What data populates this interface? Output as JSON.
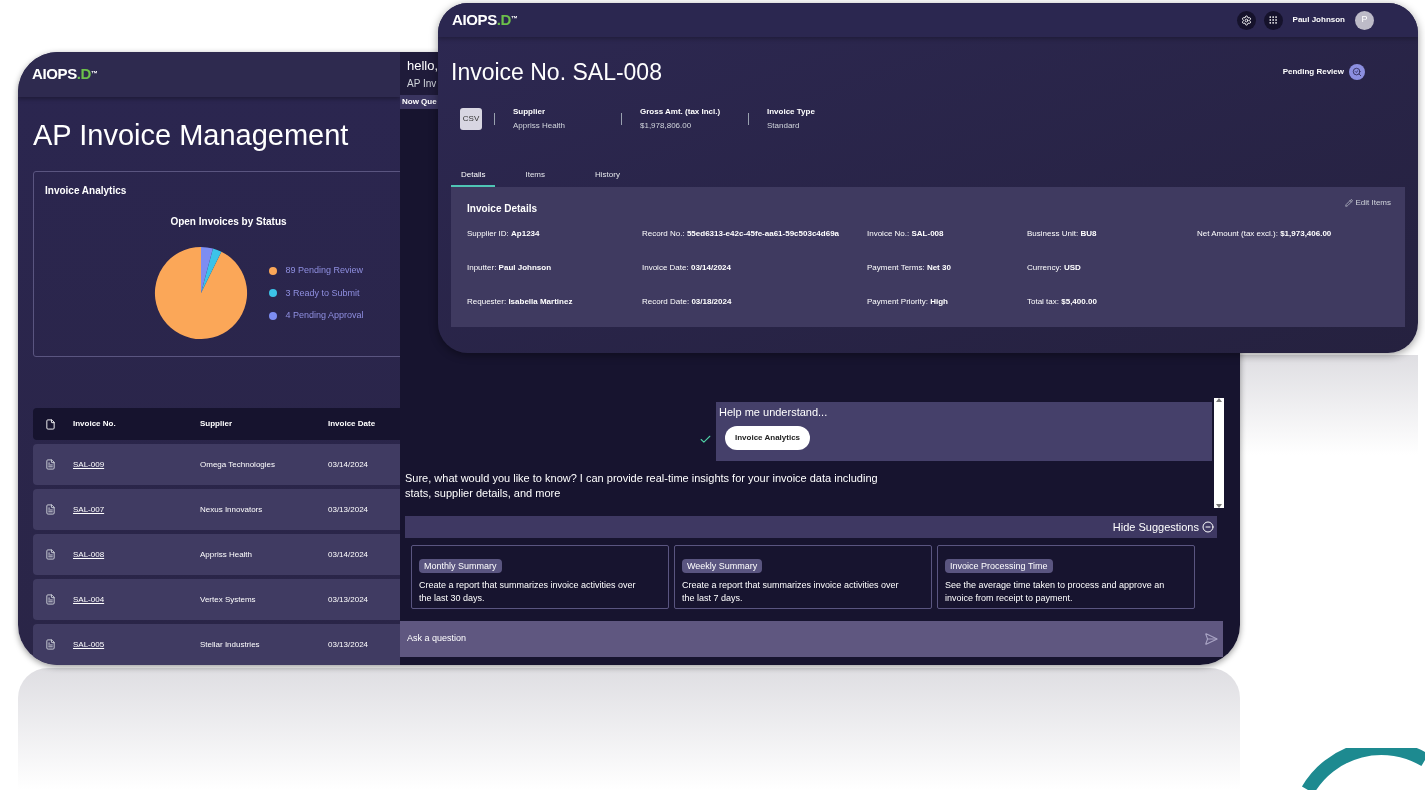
{
  "dashboard": {
    "logo": {
      "text": "AIOPS",
      "accent": ".D",
      "mark": "™"
    },
    "title": "AP Invoice Management",
    "analytics": {
      "title": "Invoice Analytics",
      "chart_data": {
        "type": "pie",
        "title": "Open Invoices by Status",
        "categories": [
          "89 Pending Review",
          "3 Ready to Submit",
          "4 Pending Approval"
        ],
        "values": [
          89,
          3,
          4
        ],
        "legend": "right",
        "colors": [
          "#fba758",
          "#3cc3e8",
          "#7d8df2"
        ]
      }
    },
    "table": {
      "columns": [
        "Invoice No.",
        "Supplier",
        "Invoice Date"
      ],
      "rows": [
        [
          "SAL-009",
          "Omega Technologies",
          "03/14/2024"
        ],
        [
          "SAL-007",
          "Nexus Innovators",
          "03/13/2024"
        ],
        [
          "SAL-008",
          "Appriss Health",
          "03/14/2024"
        ],
        [
          "SAL-004",
          "Vertex Systems",
          "03/13/2024"
        ],
        [
          "SAL-005",
          "Stellar Industries",
          "03/13/2024"
        ]
      ]
    }
  },
  "chat": {
    "greeting": "hello,",
    "subtitle": "AP Inv",
    "section": "Now Que",
    "prompt": {
      "text": "Help me understand...",
      "button": "Invoice Analytics",
      "answered": true
    },
    "reply": "Sure, what would you like to know? I can provide real-time insights for your invoice data including stats, supplier details, and more",
    "suggestions_toggle": "Hide Suggestions",
    "suggestions": [
      {
        "tag": "Monthly Summary",
        "text": "Create a report that summarizes invoice activities over the last 30 days."
      },
      {
        "tag": "Weekly Summary",
        "text": "Create a report that summarizes invoice activities over the last 7 days."
      },
      {
        "tag": "Invoice Processing Time",
        "text": "See the average time taken to process and approve an invoice from receipt to payment."
      }
    ],
    "input": {
      "placeholder": "Ask a question"
    }
  },
  "invoice": {
    "logo": {
      "text": "AIOPS",
      "accent": ".D",
      "mark": "™"
    },
    "user": {
      "name": "Paul Johnson",
      "initial": "P"
    },
    "title": "Invoice No. SAL-008",
    "status": "Pending Review",
    "file_type": "CSV",
    "summary": [
      {
        "label": "Supplier",
        "value": "Appriss Health"
      },
      {
        "label": "Gross Amt. (tax Incl.)",
        "value": "$1,978,806.00"
      },
      {
        "label": "Invoice Type",
        "value": "Standard"
      }
    ],
    "tabs": [
      {
        "label": "Details",
        "selected": true
      },
      {
        "label": "Items",
        "selected": false
      },
      {
        "label": "History",
        "selected": false
      }
    ],
    "details": {
      "title": "Invoice Details",
      "edit": "Edit Items",
      "rows": [
        [
          {
            "label": "Supplier ID:",
            "value": "Ap1234"
          },
          {
            "label": "Record No.:",
            "value": "55ed6313-e42c-45fe-aa61-59c503c4d69a"
          },
          {
            "label": "Invoice No.:",
            "value": "SAL-008"
          },
          {
            "label": "Business Unit:",
            "value": "BU8"
          },
          {
            "label": "Net Amount (tax excl.):",
            "value": "$1,973,406.00"
          }
        ],
        [
          {
            "label": "Inputter:",
            "value": "Paul Johnson"
          },
          {
            "label": "Invoice Date:",
            "value": "03/14/2024"
          },
          {
            "label": "Payment Terms:",
            "value": "Net 30"
          },
          {
            "label": "Currency:",
            "value": "USD"
          }
        ],
        [
          {
            "label": "Requester:",
            "value": "Isabella Martinez"
          },
          {
            "label": "Record Date:",
            "value": "03/18/2024"
          },
          {
            "label": "Payment Priority:",
            "value": "High"
          },
          {
            "label": "Total tax:",
            "value": "$5,400.00"
          }
        ]
      ]
    }
  }
}
